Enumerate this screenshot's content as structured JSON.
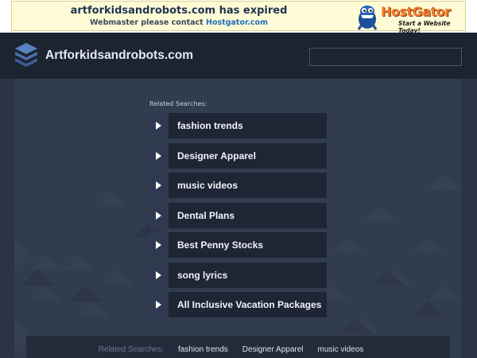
{
  "banner": {
    "title": "artforkidsandrobots.com has expired",
    "subtitle_prefix": "Webmaster please contact ",
    "subtitle_link": "Hostgator.com",
    "brand": "HostGator",
    "tagline": "Start a Website Today!"
  },
  "header": {
    "site_title": "Artforkidsandrobots.com",
    "search_value": "",
    "search_placeholder": ""
  },
  "related": {
    "label": "Related Searches:",
    "items": [
      {
        "label": "fashion trends"
      },
      {
        "label": "Designer Apparel"
      },
      {
        "label": "music videos"
      },
      {
        "label": "Dental Plans"
      },
      {
        "label": "Best Penny Stocks"
      },
      {
        "label": "song lyrics"
      },
      {
        "label": "All Inclusive Vacation Packages"
      }
    ]
  },
  "bottom": {
    "label": "Related Searches:",
    "links": [
      "fashion trends",
      "Designer Apparel",
      "music videos"
    ]
  },
  "colors": {
    "background": "#2b3444",
    "header": "#1c2331",
    "item_bg": "#1e2535",
    "arrow_bg": "#2f3a52",
    "brand_orange": "#f37b2b"
  }
}
